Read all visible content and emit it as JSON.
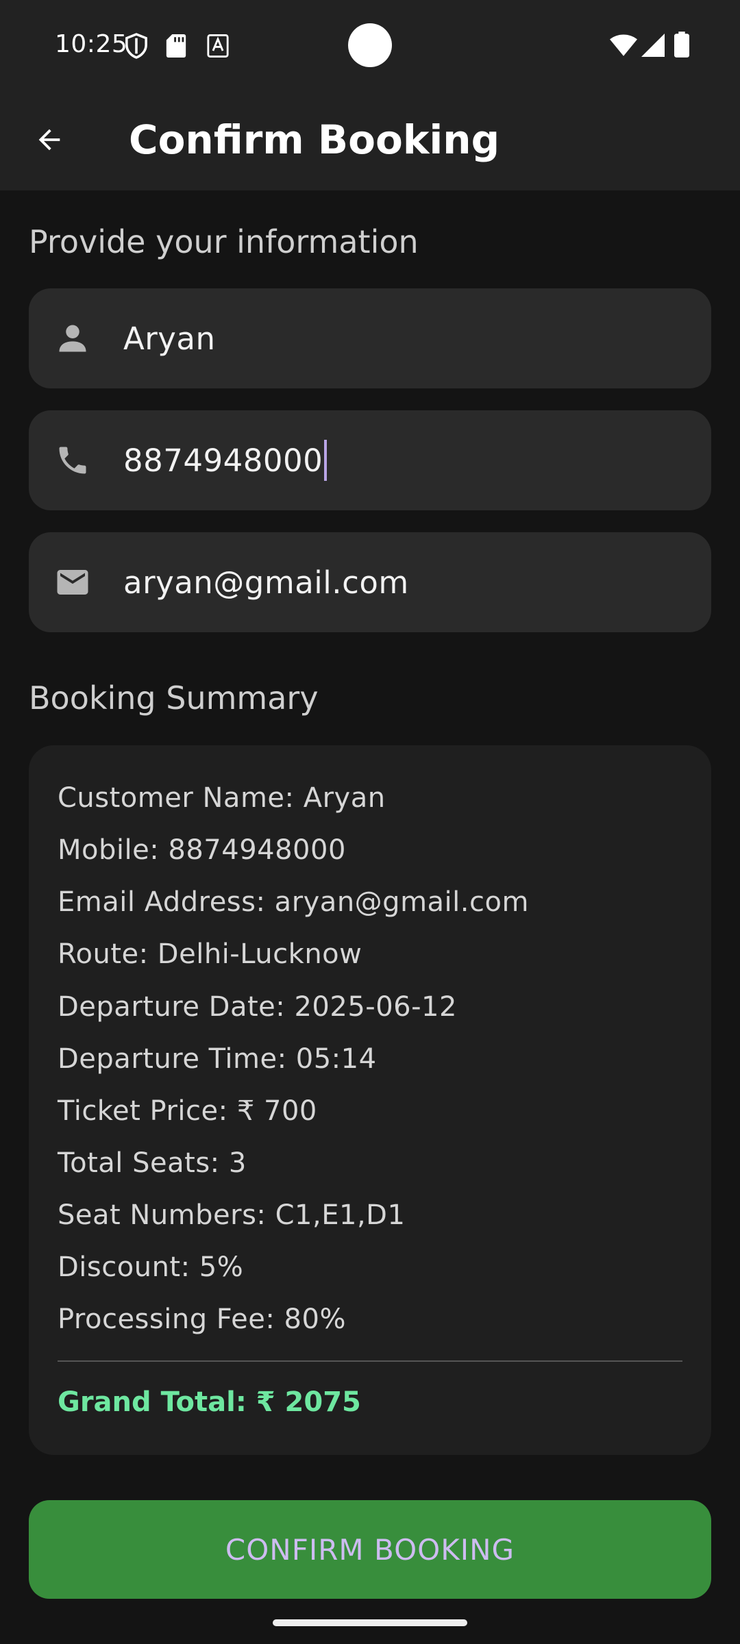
{
  "status_bar": {
    "time": "10:25",
    "left_icons": [
      "shield-icon",
      "sd-card-icon",
      "a-box-icon"
    ],
    "right_icons": [
      "wifi-icon",
      "signal-icon",
      "battery-icon"
    ]
  },
  "app_bar": {
    "back_icon": "arrow-back-icon",
    "title": "Confirm Booking"
  },
  "form": {
    "section_title": "Provide your information",
    "fields": [
      {
        "icon": "person-icon",
        "value": "Aryan"
      },
      {
        "icon": "phone-icon",
        "value": "8874948000",
        "focused": true
      },
      {
        "icon": "mail-icon",
        "value": "aryan@gmail.com"
      }
    ]
  },
  "summary": {
    "section_title": "Booking Summary",
    "lines": [
      "Customer Name: Aryan",
      "Mobile: 8874948000",
      "Email Address: aryan@gmail.com",
      "Route: Delhi-Lucknow",
      "Departure Date: 2025-06-12",
      "Departure Time: 05:14",
      "Ticket Price: ₹ 700",
      "Total Seats: 3",
      "Seat Numbers: C1,E1,D1",
      "Discount: 5%",
      "Processing Fee: 80%"
    ],
    "grand_total": "Grand Total: ₹ 2075"
  },
  "confirm_button": {
    "label": "CONFIRM BOOKING"
  },
  "colors": {
    "background": "#141414",
    "app_bar": "#222222",
    "field": "#2a2a2a",
    "card": "#1f1f1f",
    "accent_green": "#388e3c",
    "total_green": "#6ee7a0",
    "button_text": "#cdbcf0"
  }
}
